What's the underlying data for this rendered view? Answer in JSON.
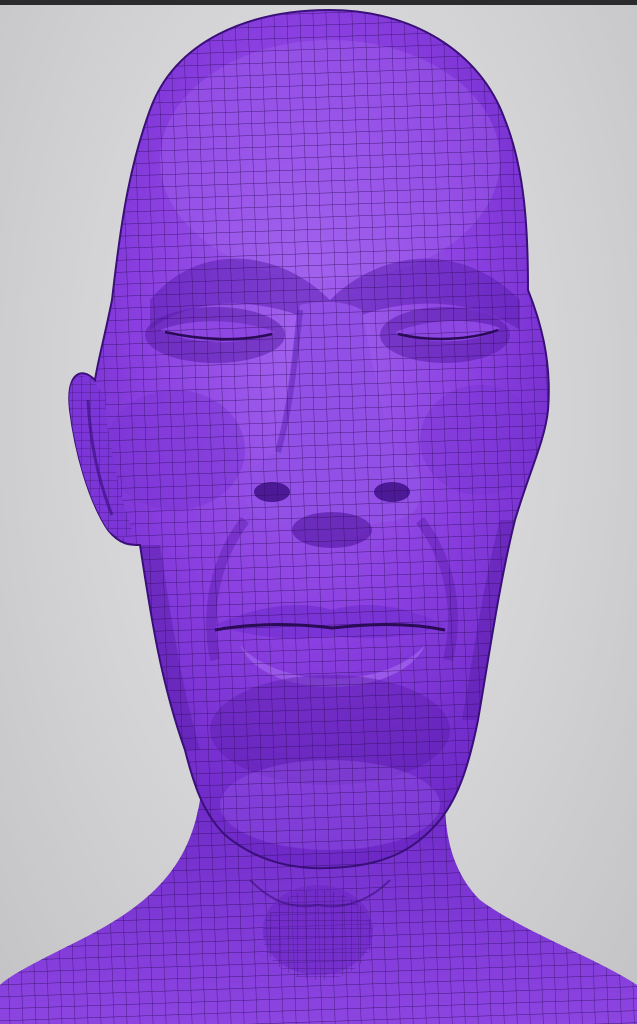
{
  "viewport": {
    "background": "#d3d3d5",
    "top_bar": "#2b2b2e"
  },
  "model": {
    "subject": "wireframe-head-mesh",
    "shading": "flat-purple",
    "base_color": "#8a3fe0",
    "shadow_color": "#5a1fae",
    "highlight_color": "#a86af0",
    "wire_color": "#2a0b55"
  }
}
